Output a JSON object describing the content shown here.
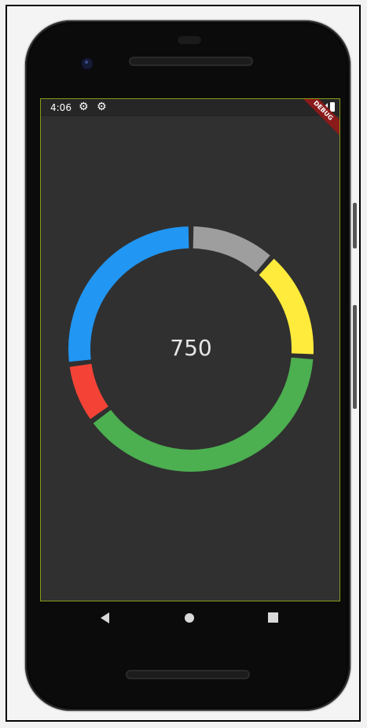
{
  "status_bar": {
    "time": "4:06",
    "gear_icon": "gear-icon",
    "debug_label": "DEBUG"
  },
  "ring_chart": {
    "center_value": "750",
    "colors": {
      "gray": "#9e9e9e",
      "yellow": "#ffeb3b",
      "green": "#4caf50",
      "red": "#f44336",
      "blue": "#2196f3"
    },
    "chart_data": {
      "type": "pie",
      "categories": [
        "gray",
        "yellow",
        "green",
        "red",
        "blue"
      ],
      "values": [
        11.5,
        14.5,
        39,
        8,
        27
      ]
    }
  },
  "nav": {
    "back_icon": "back-icon",
    "home_icon": "home-icon",
    "recents_icon": "recents-icon"
  }
}
